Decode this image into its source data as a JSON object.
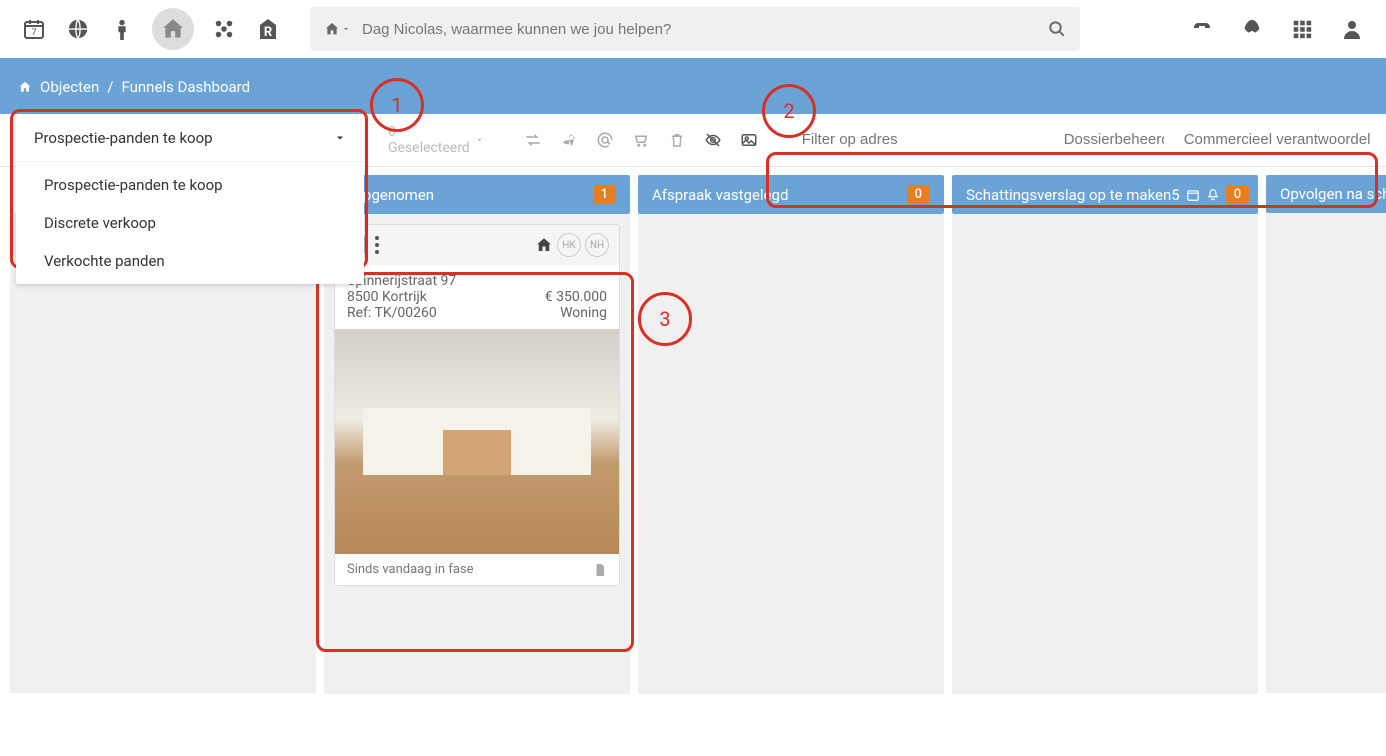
{
  "topbar": {
    "search_placeholder": "Dag Nicolas, waarmee kunnen we jou helpen?",
    "calendar_day": "7",
    "r_logo": "R"
  },
  "breadcrumb": {
    "home_label": "Objecten",
    "current_label": "Funnels Dashboard",
    "separator": "/"
  },
  "filter_select": {
    "selected": "Prospectie-panden te koop",
    "options": [
      "Prospectie-panden te koop",
      "Discrete verkoop",
      "Verkochte panden"
    ]
  },
  "annotations": {
    "n1": "1",
    "n2": "2",
    "n3": "3"
  },
  "toolbar": {
    "selected_label": "0 Geselecteerd",
    "filter_address_placeholder": "Filter op adres",
    "filter_dossier_placeholder": "Dossierbeheerder",
    "filter_comm_placeholder": "Commercieel verantwoordelijke"
  },
  "columns": [
    {
      "title": "",
      "count": ""
    },
    {
      "title": "ct opgenomen",
      "count": "1"
    },
    {
      "title": "Afspraak vastgelegd",
      "count": "0"
    },
    {
      "title": "Schattingsverslag op te maken",
      "count": "0",
      "extra_count": "5"
    },
    {
      "title": "Opvolgen na scha",
      "count": ""
    }
  ],
  "card": {
    "address_line1": "Spinnerijstraat 97",
    "address_line2": "8500 Kortrijk",
    "ref": "Ref: TK/00260",
    "price": "€ 350.000",
    "type": "Woning",
    "footer": "Sinds vandaag in fase",
    "avatar1": "HK",
    "avatar2": "NH"
  }
}
